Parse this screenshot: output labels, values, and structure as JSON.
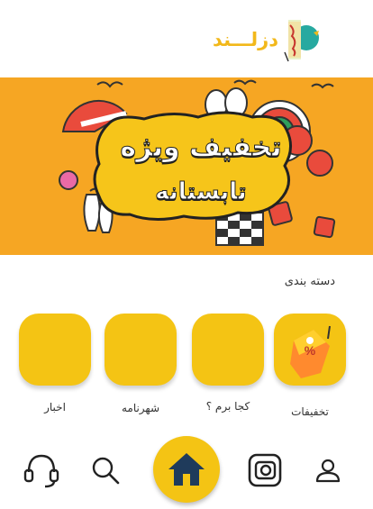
{
  "brand": {
    "logo_text": "دزلـــند",
    "accent": "#f4c414",
    "banner_bg": "#f6a623"
  },
  "banner": {
    "line1": "تخفیف ویژه",
    "line2": "تابستانه"
  },
  "categories_title": "دسته بندی",
  "categories": [
    {
      "label": "تخفیفات",
      "icon": "discount-tag-icon"
    },
    {
      "label": "کجا برم ؟",
      "icon": ""
    },
    {
      "label": "شهرنامه",
      "icon": ""
    },
    {
      "label": "اخبار",
      "icon": ""
    }
  ],
  "bottom_nav": [
    {
      "icon": "profile-icon"
    },
    {
      "icon": "instagram-icon"
    },
    {
      "icon": "home-icon"
    },
    {
      "icon": "search-icon"
    },
    {
      "icon": "support-headset-icon"
    }
  ]
}
